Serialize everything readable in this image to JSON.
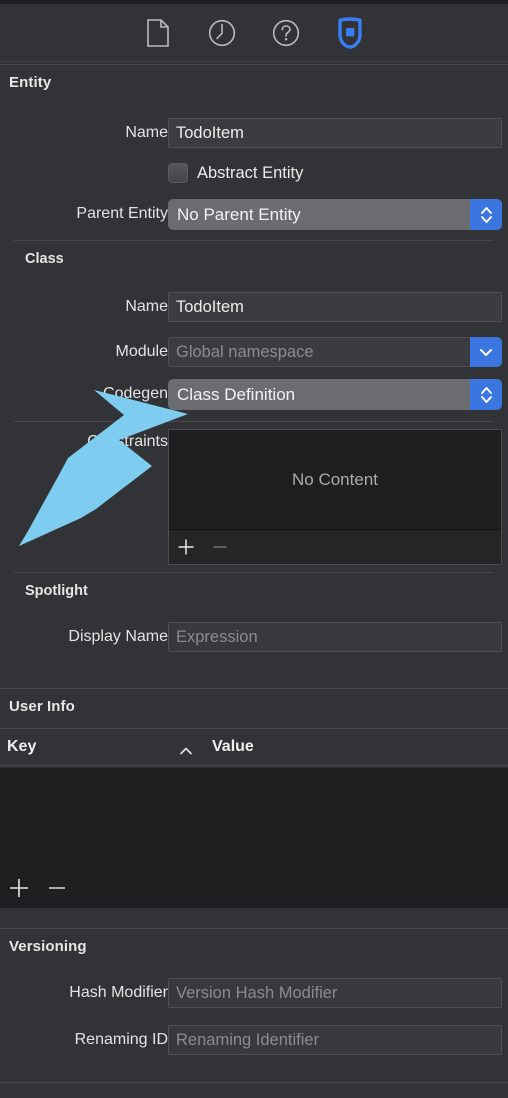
{
  "toolbar": {
    "icons": [
      {
        "name": "file-icon",
        "label": "File Inspector",
        "selected": false
      },
      {
        "name": "history-icon",
        "label": "History Inspector",
        "selected": false
      },
      {
        "name": "help-icon",
        "label": "Quick Help Inspector",
        "selected": false
      },
      {
        "name": "data-model-icon",
        "label": "Data Model Inspector",
        "selected": true
      }
    ],
    "accent_color": "#3a7ef5"
  },
  "entity": {
    "section_title": "Entity",
    "name_label": "Name",
    "name_value": "TodoItem",
    "abstract_label": "Abstract Entity",
    "abstract_checked": false,
    "parent_label": "Parent Entity",
    "parent_value": "No Parent Entity"
  },
  "class": {
    "section_title": "Class",
    "name_label": "Name",
    "name_value": "TodoItem",
    "module_label": "Module",
    "module_placeholder": "Global namespace",
    "module_value": "",
    "codegen_label": "Codegen",
    "codegen_value": "Class Definition"
  },
  "constraints": {
    "label": "Constraints",
    "empty_text": "No Content",
    "add_label": "+",
    "remove_label": "—"
  },
  "spotlight": {
    "section_title": "Spotlight",
    "display_name_label": "Display Name",
    "display_name_placeholder": "Expression",
    "display_name_value": ""
  },
  "user_info": {
    "section_title": "User Info",
    "key_column": "Key",
    "value_column": "Value",
    "sort_indicator": "ascending",
    "rows": [],
    "add_label": "+",
    "remove_label": "—"
  },
  "versioning": {
    "section_title": "Versioning",
    "hash_modifier_label": "Hash Modifier",
    "hash_modifier_placeholder": "Version Hash Modifier",
    "hash_modifier_value": "",
    "renaming_id_label": "Renaming ID",
    "renaming_id_placeholder": "Renaming Identifier",
    "renaming_id_value": ""
  },
  "annotation": {
    "name": "pointer-arrow",
    "color": "#7ecdf0",
    "points_at": "codegen-popup-button"
  }
}
